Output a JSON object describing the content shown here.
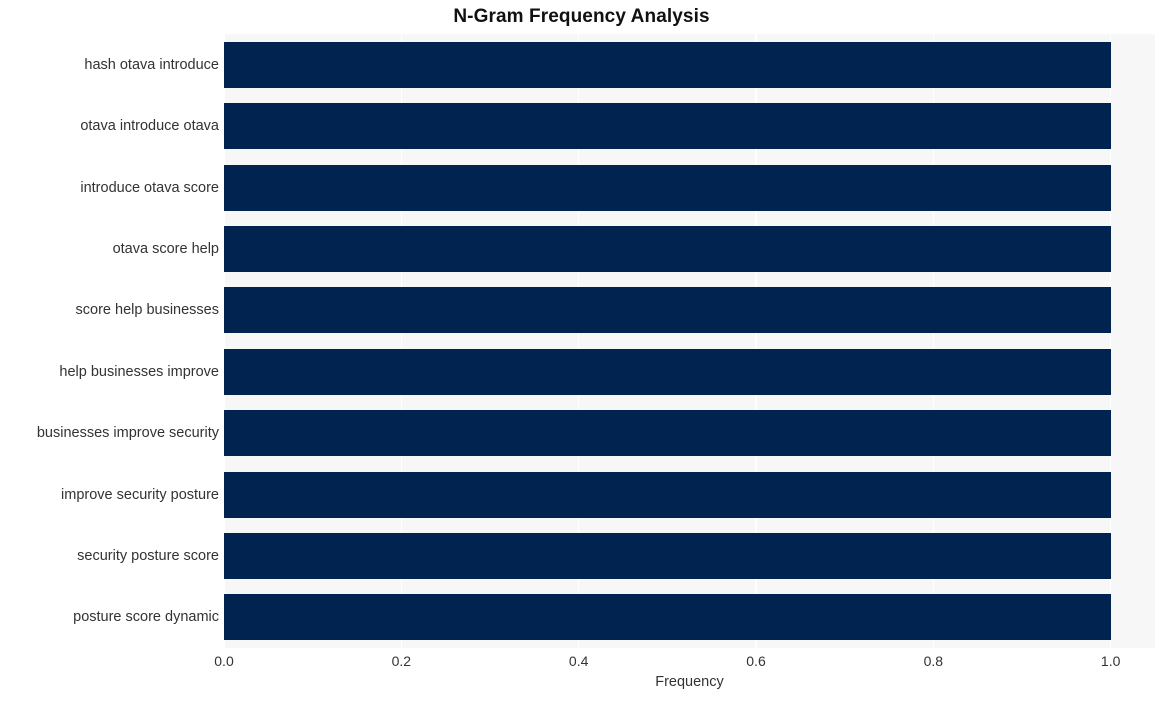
{
  "chart_data": {
    "type": "bar",
    "orientation": "horizontal",
    "title": "N-Gram Frequency Analysis",
    "xlabel": "Frequency",
    "ylabel": "",
    "categories": [
      "hash otava introduce",
      "otava introduce otava",
      "introduce otava score",
      "otava score help",
      "score help businesses",
      "help businesses improve",
      "businesses improve security",
      "improve security posture",
      "security posture score",
      "posture score dynamic"
    ],
    "values": [
      1.0,
      1.0,
      1.0,
      1.0,
      1.0,
      1.0,
      1.0,
      1.0,
      1.0,
      1.0
    ],
    "xlim": [
      0.0,
      1.05
    ],
    "xticks": [
      0.0,
      0.2,
      0.4,
      0.6,
      0.8,
      1.0
    ],
    "xticklabels": [
      "0.0",
      "0.2",
      "0.4",
      "0.6",
      "0.8",
      "1.0"
    ],
    "grid": true,
    "grid_axis": "x",
    "legend": false,
    "bar_color": "#01234f",
    "plot_background": "#f7f7f7",
    "figure_background": "#ffffff",
    "gridline_color": "#ffffff",
    "title_color": "#111111",
    "tick_label_color": "#333333"
  }
}
